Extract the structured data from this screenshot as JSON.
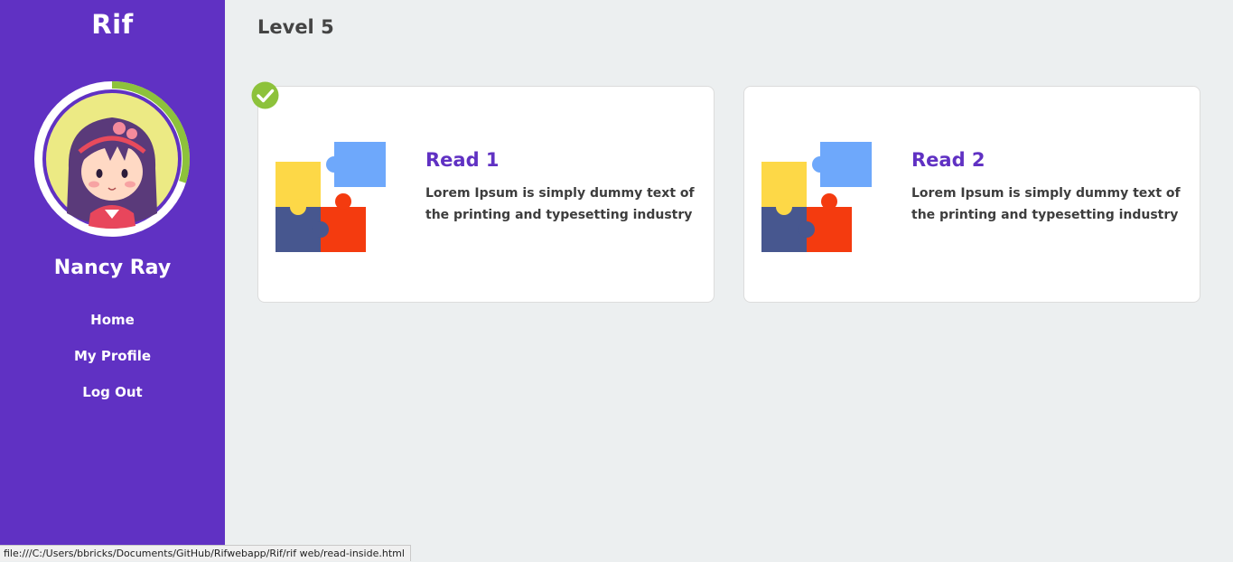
{
  "sidebar": {
    "brand": "Rif",
    "user_name": "Nancy Ray",
    "avatar_progress_percent": 30,
    "nav": [
      {
        "label": "Home"
      },
      {
        "label": "My Profile"
      },
      {
        "label": "Log Out"
      }
    ]
  },
  "main": {
    "title": "Level 5",
    "cards": [
      {
        "title": "Read 1",
        "description": "Lorem Ipsum is simply dummy text of the printing and typesetting industry",
        "completed": true,
        "icon": "puzzle-icon"
      },
      {
        "title": "Read 2",
        "description": "Lorem Ipsum is simply dummy text of the printing and typesetting industry",
        "completed": false,
        "icon": "puzzle-icon"
      }
    ]
  },
  "status_bar": {
    "url": "file:///C:/Users/bbricks/Documents/GitHub/Rifwebapp/Rif/rif web/read-inside.html"
  },
  "colors": {
    "sidebar": "#6031c3",
    "accent_green": "#8dc23b",
    "title_purple": "#6031c3",
    "background": "#eceff0"
  }
}
